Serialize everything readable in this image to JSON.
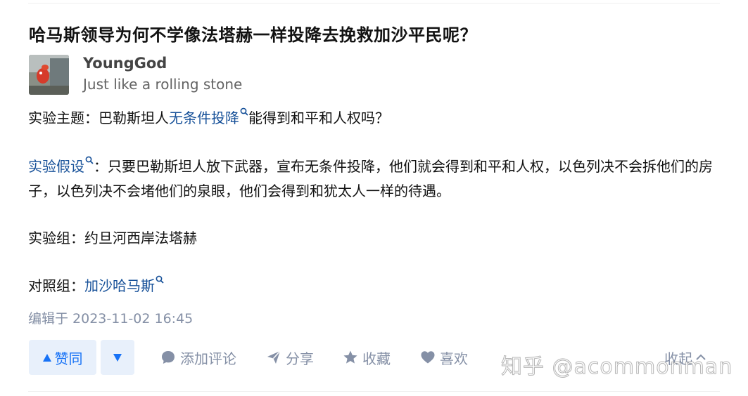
{
  "question": {
    "title": "哈马斯领导为何不学像法塔赫一样投降去挽救加沙平民呢？"
  },
  "author": {
    "name": "YoungGod",
    "bio": "Just like a rolling stone"
  },
  "content": {
    "p1": {
      "label": "实验主题：",
      "text_before": "巴勒斯坦人",
      "link": "无条件投降",
      "text_after": "能得到和平和人权吗？"
    },
    "p2": {
      "link": "实验假设",
      "text": "：只要巴勒斯坦人放下武器，宣布无条件投降，他们就会得到和平和人权，以色列决不会拆他们的房子，以色列决不会堵他们的泉眼，他们会得到和犹太人一样的待遇。"
    },
    "p3": {
      "text": "实验组：约旦河西岸法塔赫"
    },
    "p4": {
      "label": "对照组：",
      "link": "加沙哈马斯"
    }
  },
  "edit_time": "编辑于 2023-11-02 16:45",
  "actions": {
    "vote_up": "赞同",
    "comment": "添加评论",
    "share": "分享",
    "favorite": "收藏",
    "like": "喜欢",
    "collapse": "收起"
  },
  "watermark": "知乎 @acommonman",
  "colors": {
    "link": "#175199",
    "accent": "#1772f6",
    "muted": "#8590a6",
    "vote_bg": "#e8f0fb"
  }
}
